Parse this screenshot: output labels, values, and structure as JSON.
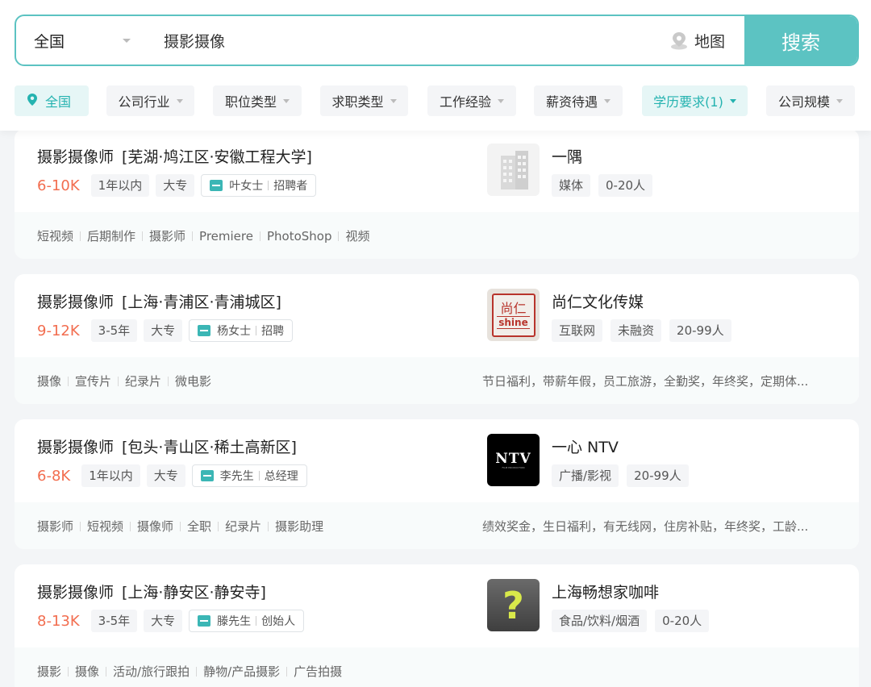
{
  "search": {
    "city": "全国",
    "query": "摄影摄像",
    "map_label": "地图",
    "button_label": "搜索"
  },
  "filters": [
    {
      "label": "全国",
      "active": true
    },
    {
      "label": "公司行业"
    },
    {
      "label": "职位类型"
    },
    {
      "label": "求职类型"
    },
    {
      "label": "工作经验"
    },
    {
      "label": "薪资待遇"
    },
    {
      "label": "学历要求(1)",
      "active": true
    },
    {
      "label": "公司规模"
    }
  ],
  "colors": {
    "accent": "#5cc3c2",
    "salary": "#f26d4f"
  },
  "jobs": [
    {
      "title": "摄影摄像师",
      "location": "[芜湖·鸠江区·安徽工程大学]",
      "salary": "6-10K",
      "experience": "1年以内",
      "education": "大专",
      "recruiter_name": "叶女士",
      "recruiter_role": "招聘者",
      "company": "一隅",
      "company_tags": [
        "媒体",
        "0-20人"
      ],
      "logo": "building-icon",
      "skills": [
        "短视频",
        "后期制作",
        "摄影师",
        "Premiere",
        "PhotoShop",
        "视频"
      ],
      "benefits": ""
    },
    {
      "title": "摄影摄像师",
      "location": "[上海·青浦区·青浦城区]",
      "salary": "9-12K",
      "experience": "3-5年",
      "education": "大专",
      "recruiter_name": "杨女士",
      "recruiter_role": "招聘",
      "company": "尚仁文化传媒",
      "company_tags": [
        "互联网",
        "未融资",
        "20-99人"
      ],
      "logo": "shine-logo",
      "logo_text_top": "尚仁",
      "logo_text_bottom": "shine",
      "skills": [
        "摄像",
        "宣传片",
        "纪录片",
        "微电影"
      ],
      "benefits": "节日福利，带薪年假，员工旅游，全勤奖，年终奖，定期体..."
    },
    {
      "title": "摄影摄像师",
      "location": "[包头·青山区·稀土高新区]",
      "salary": "6-8K",
      "experience": "1年以内",
      "education": "大专",
      "recruiter_name": "李先生",
      "recruiter_role": "总经理",
      "company": "一心 NTV",
      "company_tags": [
        "广播/影视",
        "20-99人"
      ],
      "logo": "ntv-logo",
      "logo_text": "NTV",
      "logo_subtext": "FILM PRODUCTION",
      "skills": [
        "摄影师",
        "短视频",
        "摄像师",
        "全职",
        "纪录片",
        "摄影助理"
      ],
      "benefits": "绩效奖金，生日福利，有无线网，住房补贴，年终奖，工龄..."
    },
    {
      "title": "摄影摄像师",
      "location": "[上海·静安区·静安寺]",
      "salary": "8-13K",
      "experience": "3-5年",
      "education": "大专",
      "recruiter_name": "滕先生",
      "recruiter_role": "创始人",
      "company": "上海畅想家咖啡",
      "company_tags": [
        "食品/饮料/烟酒",
        "0-20人"
      ],
      "logo": "question-mark-logo",
      "logo_text": "?",
      "skills": [
        "摄影",
        "摄像",
        "活动/旅行跟拍",
        "静物/产品摄影",
        "广告拍摄"
      ],
      "benefits": ""
    }
  ]
}
